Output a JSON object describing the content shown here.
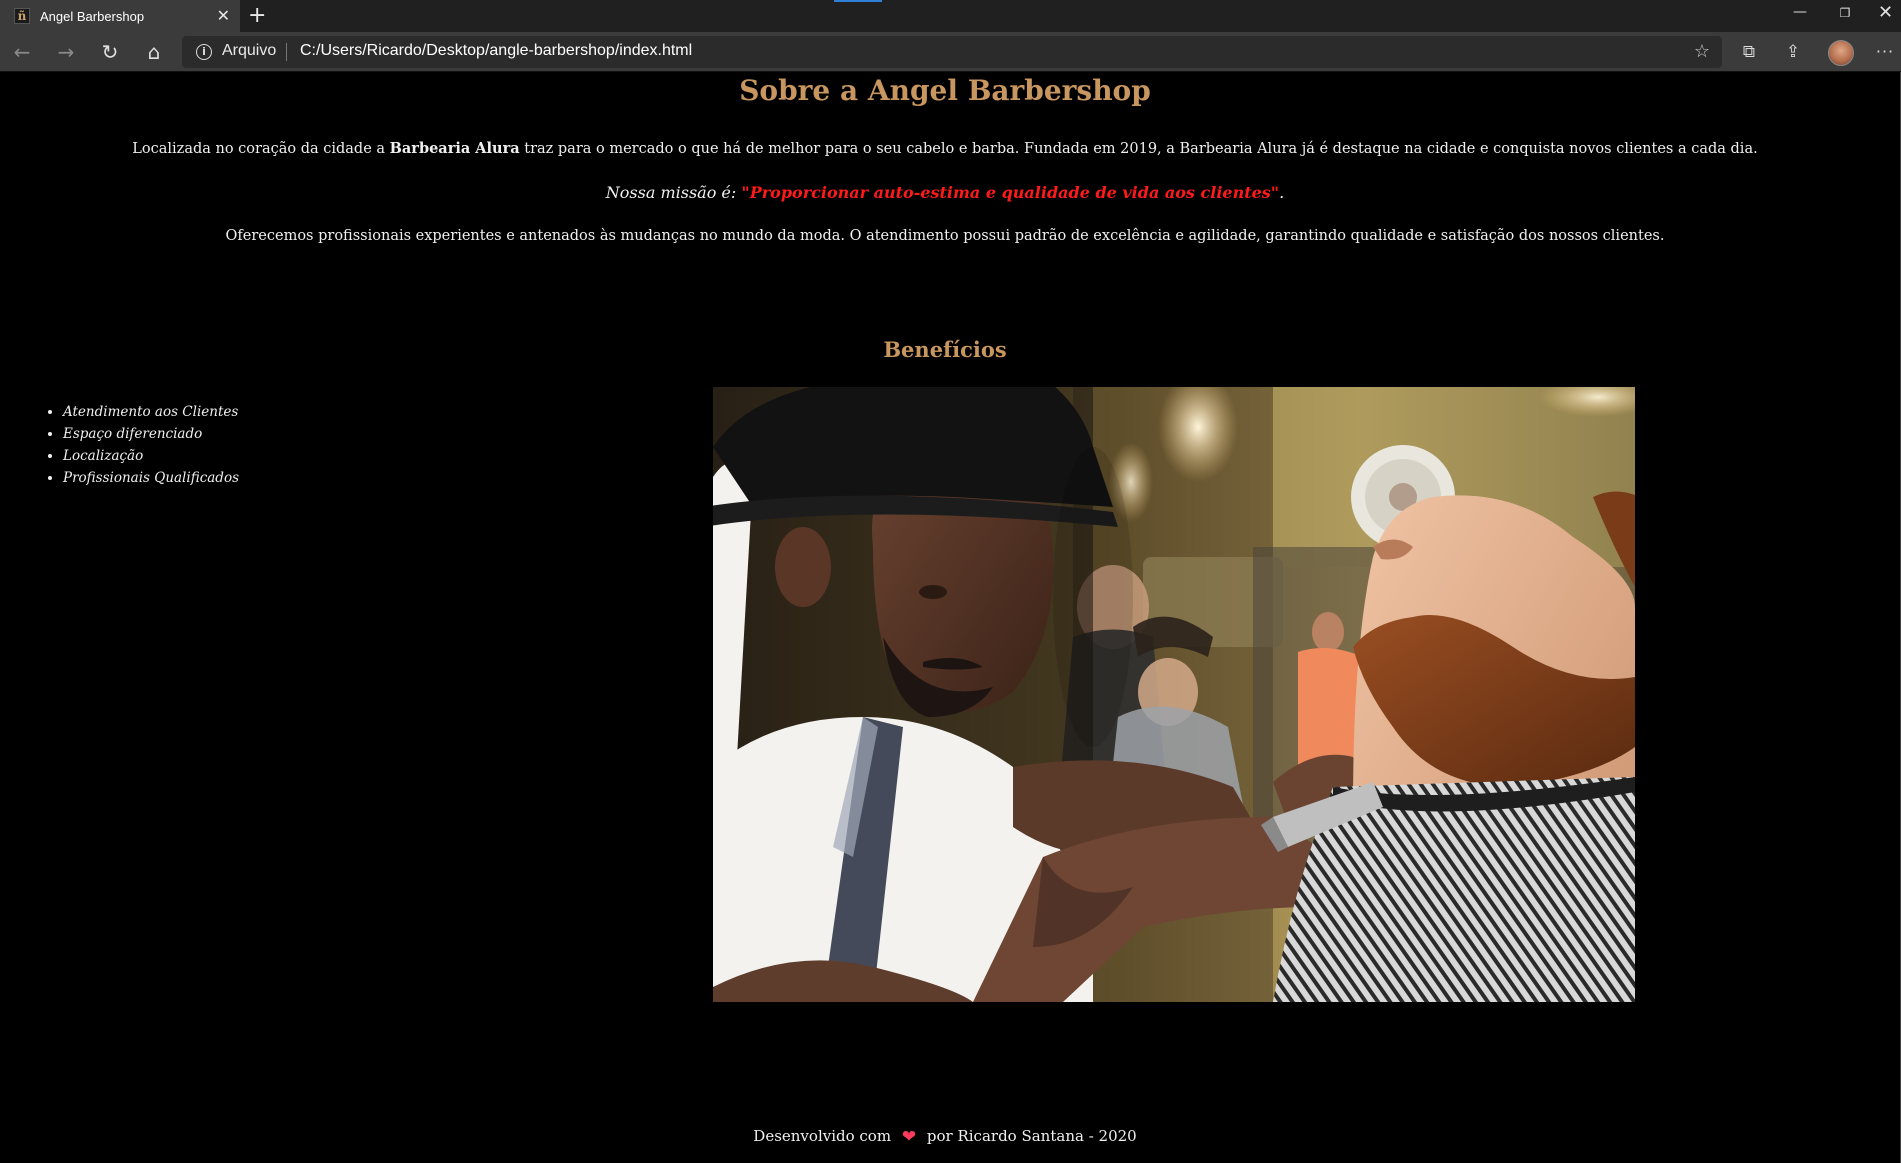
{
  "browser": {
    "tab_title": "Angel Barbershop",
    "tab_favicon_letter": "ñ",
    "tab_close": "✕",
    "new_tab": "+",
    "address": {
      "scheme_label": "Arquivo",
      "url": "C:/Users/Ricardo/Desktop/angle-barbershop/index.html"
    },
    "icons": {
      "back": "←",
      "forward": "→",
      "reload": "↻",
      "home": "⌂",
      "info": "i",
      "favorite": "☆",
      "collections": "⧉",
      "share": "⇪",
      "more": "···",
      "minimize": "—",
      "maximize": "❐",
      "close": "✕"
    }
  },
  "page": {
    "title": "Sobre a Angel Barbershop",
    "intro": {
      "before": "Localizada no coração da cidade a ",
      "bold": "Barbearia Alura",
      "after": " traz para o mercado o que há de melhor para o seu cabelo e barba. Fundada em 2019, a Barbearia Alura já é destaque na cidade e conquista novos clientes a cada dia."
    },
    "mission": {
      "label": "Nossa missão é: ",
      "quote": "\"Proporcionar auto-estima e qualidade de vida aos clientes\"",
      "end": "."
    },
    "offer": "Oferecemos profissionais experientes e antenados às mudanças no mundo da moda. O atendimento possui padrão de excelência e agilidade, garantindo qualidade e satisfação dos nossos clientes.",
    "benefits_title": "Benefícios",
    "benefits": [
      "Atendimento aos Clientes",
      "Espaço diferenciado",
      "Localização",
      "Profissionais Qualificados"
    ],
    "footer": {
      "before": "Desenvolvido com",
      "heart": "❤",
      "after": "por Ricardo Santana - 2020"
    }
  },
  "colors": {
    "accent_title": "#c8965f",
    "mission_quote": "#ff1a1a",
    "heart": "#ff3b5c",
    "page_background": "#000000"
  }
}
